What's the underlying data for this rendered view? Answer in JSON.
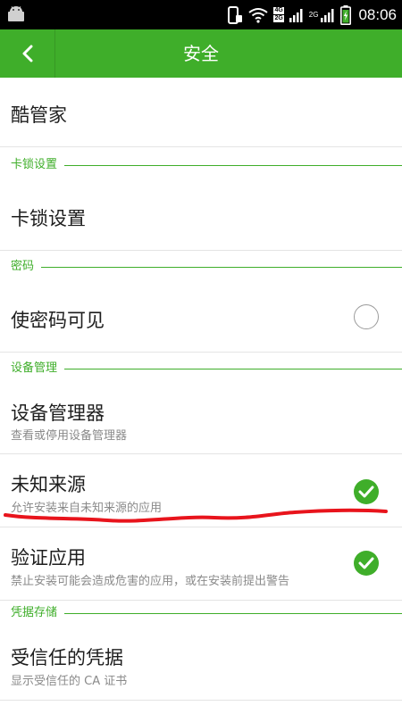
{
  "status_bar": {
    "time": "08:06",
    "network_top": "4G",
    "network_bottom": "2G",
    "network_secondary": "2G"
  },
  "action_bar": {
    "title": "安全"
  },
  "items": {
    "kugj": {
      "label": "酷管家"
    },
    "sec_lock": {
      "label": "卡锁设置"
    },
    "lock_settings": {
      "label": "卡锁设置"
    },
    "sec_password": {
      "label": "密码"
    },
    "show_password": {
      "label": "使密码可见",
      "checked": false
    },
    "sec_device": {
      "label": "设备管理"
    },
    "device_admin": {
      "label": "设备管理器",
      "sub": "查看或停用设备管理器"
    },
    "unknown_sources": {
      "label": "未知来源",
      "sub": "允许安装来自未知来源的应用",
      "checked": true
    },
    "verify_apps": {
      "label": "验证应用",
      "sub": "禁止安装可能会造成危害的应用，或在安装前提出警告",
      "checked": true
    },
    "sec_credentials": {
      "label": "凭据存储"
    },
    "trusted_credentials": {
      "label": "受信任的凭据",
      "sub": "显示受信任的 CA 证书"
    }
  },
  "colors": {
    "accent": "#3fae2a",
    "annotation": "#e8141c"
  }
}
